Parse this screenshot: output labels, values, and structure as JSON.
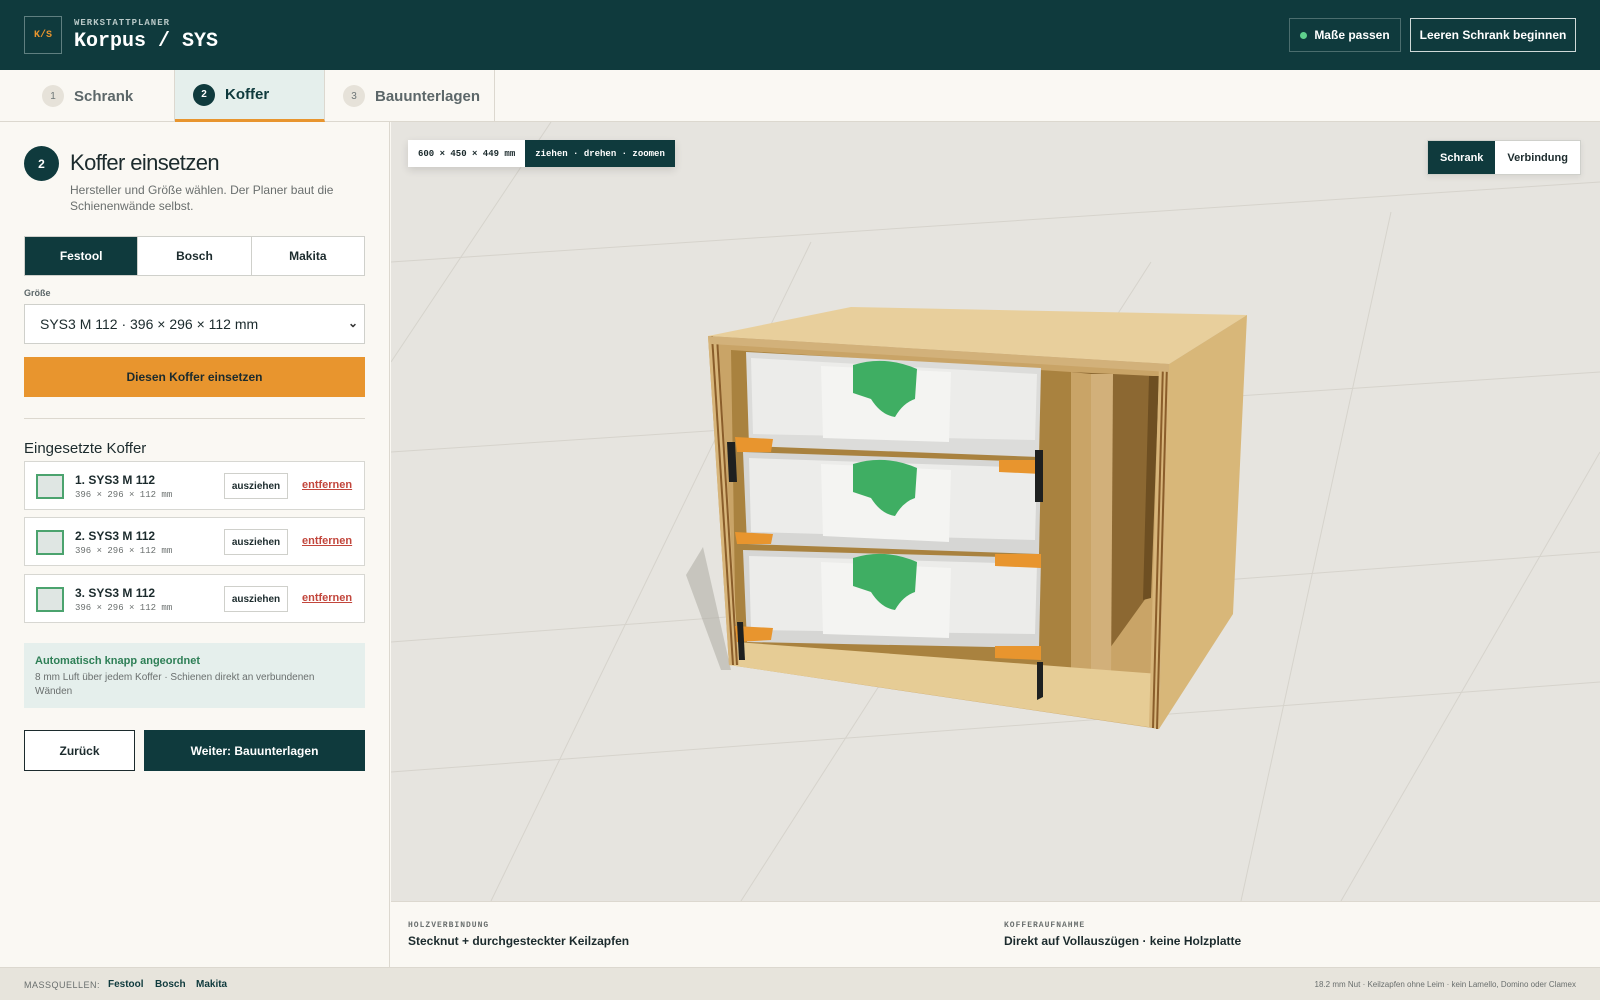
{
  "header": {
    "logo_text": "K/S",
    "kicker": "WERKSTATTPLANER",
    "title": "Korpus / SYS",
    "status_button": "Maße passen",
    "reset_button": "Leeren Schrank beginnen",
    "status_color": "#5fd08e"
  },
  "steps": [
    {
      "num": "1",
      "label": "Schrank",
      "active": false
    },
    {
      "num": "2",
      "label": "Koffer",
      "active": true
    },
    {
      "num": "3",
      "label": "Bauunterlagen",
      "active": false
    }
  ],
  "panel": {
    "step_num": "2",
    "title": "Koffer einsetzen",
    "description": "Hersteller und Größe wählen. Der Planer baut die Schienenwände selbst.",
    "brands": [
      "Festool",
      "Bosch",
      "Makita"
    ],
    "selected_brand": "Festool",
    "size_label": "Größe",
    "size_value": "SYS3 M 112 · 396 × 296 × 112 mm",
    "insert_button": "Diesen Koffer einsetzen",
    "list_title": "Eingesetzte Koffer",
    "cases": [
      {
        "name": "1. SYS3 M 112",
        "dims": "396 × 296 × 112 mm",
        "pull": "ausziehen",
        "remove": "entfernen"
      },
      {
        "name": "2. SYS3 M 112",
        "dims": "396 × 296 × 112 mm",
        "pull": "ausziehen",
        "remove": "entfernen"
      },
      {
        "name": "3. SYS3 M 112",
        "dims": "396 × 296 × 112 mm",
        "pull": "ausziehen",
        "remove": "entfernen"
      }
    ],
    "info_title": "Automatisch knapp angeordnet",
    "info_text": "8 mm Luft über jedem Koffer · Schienen direkt an verbundenen Wänden",
    "back_button": "Zurück",
    "next_button": "Weiter: Bauunterlagen"
  },
  "viewport": {
    "dimensions": "600 × 450 × 449 mm",
    "hint": "ziehen · drehen · zoomen",
    "views": [
      "Schrank",
      "Verbindung"
    ],
    "active_view": "Schrank"
  },
  "infostrip": {
    "left_label": "HOLZVERBINDUNG",
    "left_value": "Stecknut + durchgesteckter Keilzapfen",
    "right_label": "KOFFERAUFNAHME",
    "right_value": "Direkt auf Vollauszügen · keine Holzplatte"
  },
  "footer": {
    "label": "MASSQUELLEN:",
    "links": [
      "Festool",
      "Bosch",
      "Makita"
    ],
    "note": "18.2 mm Nut · Keilzapfen ohne Leim · kein Lamello, Domino oder Clamex"
  },
  "colors": {
    "brand_dark": "#0f3a3d",
    "accent_orange": "#e8952e",
    "wood": "#e2c48e",
    "handle_green": "#3fae63"
  }
}
